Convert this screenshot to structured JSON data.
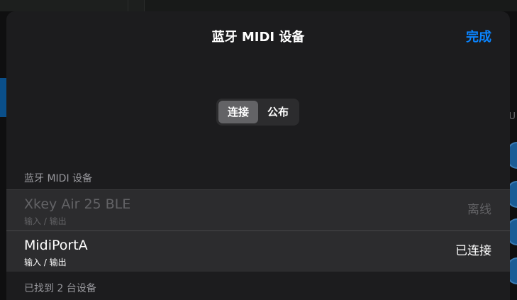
{
  "sheet": {
    "title": "蓝牙 MIDI 设备",
    "done_label": "完成"
  },
  "segmented": {
    "options": [
      "连接",
      "公布"
    ],
    "selected": "连接"
  },
  "section": {
    "header": "蓝牙 MIDI 设备",
    "footer": "已找到 2 台设备"
  },
  "devices": [
    {
      "name": "Xkey Air 25 BLE",
      "io": "输入 / 输出",
      "status": "离线"
    },
    {
      "name": "MidiPortA",
      "io": "输入 / 输出",
      "status": "已连接"
    }
  ],
  "colors": {
    "accent": "#0a84ff",
    "sheet_bg": "#1c1c1e",
    "row_bg": "#2c2c2e",
    "disabled_text": "#636366"
  }
}
